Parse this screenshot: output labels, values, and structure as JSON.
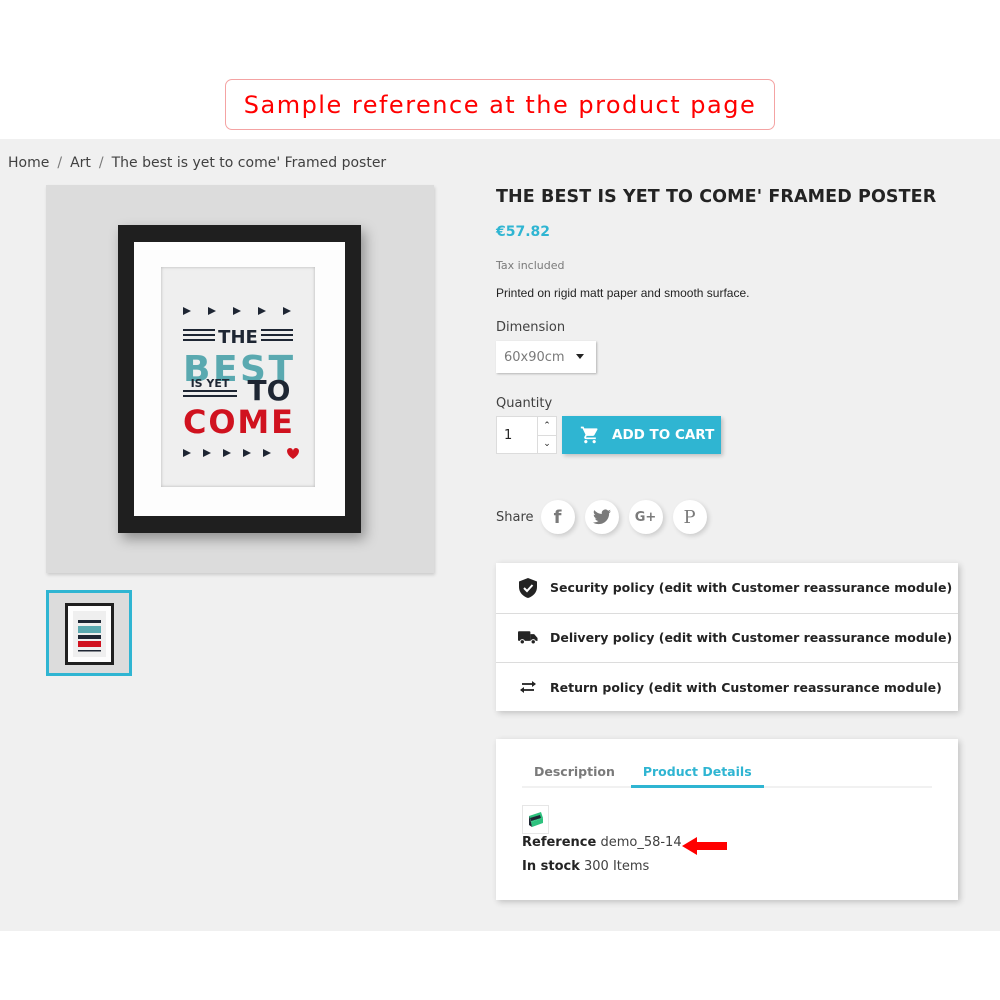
{
  "banner": {
    "text": "Sample reference at the product page"
  },
  "breadcrumb": [
    {
      "label": "Home"
    },
    {
      "label": "Art"
    },
    {
      "label": "The best is yet to come' Framed poster"
    }
  ],
  "breadcrumb_separator": "/",
  "product": {
    "title": "THE BEST IS YET TO COME' FRAMED POSTER",
    "price": "€57.82",
    "tax_note": "Tax included",
    "short_description": "Printed on rigid matt paper and smooth surface.",
    "poster_text": {
      "line1": "THE",
      "line2": "BEST",
      "line3a": "IS YET",
      "line3b": "TO",
      "line4": "COME"
    }
  },
  "dimension": {
    "label": "Dimension",
    "selected": "60x90cm"
  },
  "quantity": {
    "label": "Quantity",
    "value": "1",
    "up": "⌃",
    "down": "⌄"
  },
  "add_to_cart": {
    "label": "ADD TO CART"
  },
  "share": {
    "label": "Share",
    "networks": [
      {
        "name": "facebook",
        "glyph": "f"
      },
      {
        "name": "twitter",
        "glyph": "t"
      },
      {
        "name": "google-plus",
        "glyph": "G+"
      },
      {
        "name": "pinterest",
        "glyph": "P"
      }
    ]
  },
  "reassurance": [
    {
      "icon": "shield-check-icon",
      "text": "Security policy (edit with Customer reassurance module)"
    },
    {
      "icon": "truck-icon",
      "text": "Delivery policy (edit with Customer reassurance module)"
    },
    {
      "icon": "swap-arrows-icon",
      "text": "Return policy (edit with Customer reassurance module)"
    }
  ],
  "tabs": [
    {
      "label": "Description",
      "active": false
    },
    {
      "label": "Product Details",
      "active": true
    }
  ],
  "details": {
    "reference_label": "Reference",
    "reference_value": "demo_58-14",
    "stock_label": "In stock",
    "stock_value": "300 Items"
  },
  "colors": {
    "accent": "#2fb5d2",
    "banner_text": "#ff0000",
    "page_bg": "#f0f0f0",
    "poster_teal": "#5aa9b0",
    "poster_red": "#d0121f",
    "poster_navy": "#1e2633"
  }
}
